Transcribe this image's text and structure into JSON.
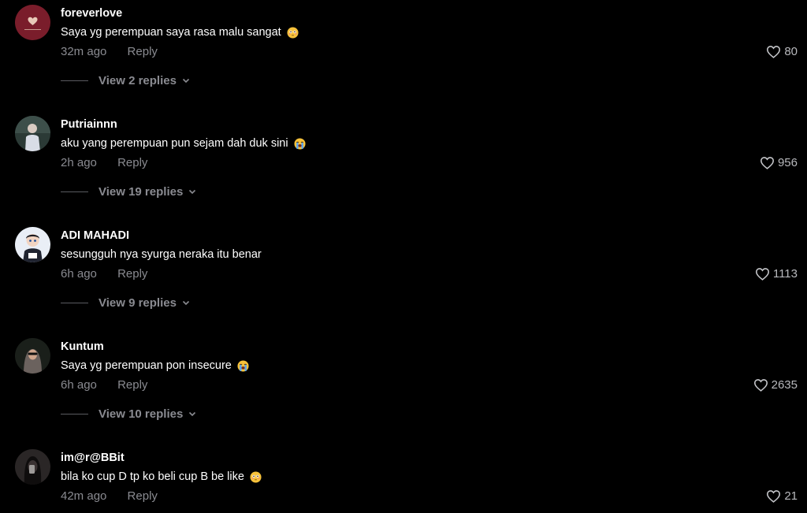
{
  "comments": [
    {
      "username": "foreverlove",
      "text": "Saya yg perempuan saya rasa malu sangat",
      "emoji": "flushed-face-emoji",
      "time": "32m ago",
      "reply": "Reply",
      "likes": "80",
      "replies": "View 2 replies"
    },
    {
      "username": "Putriainnn",
      "text": "aku yang perempuan pun sejam dah duk sini",
      "emoji": "loudly-crying-face-emoji",
      "time": "2h ago",
      "reply": "Reply",
      "likes": "956",
      "replies": "View 19 replies"
    },
    {
      "username": "ADI MAHADI",
      "text": "sesungguh nya syurga neraka itu benar",
      "emoji": "",
      "time": "6h ago",
      "reply": "Reply",
      "likes": "1113",
      "replies": "View 9 replies"
    },
    {
      "username": "Kuntum",
      "text": "Saya yg perempuan pon insecure",
      "emoji": "loudly-crying-face-emoji",
      "time": "6h ago",
      "reply": "Reply",
      "likes": "2635",
      "replies": "View 10 replies"
    },
    {
      "username": "im@r@BBit",
      "text": "bila ko cup D tp ko beli cup B be like",
      "emoji": "flushed-face-emoji",
      "time": "42m ago",
      "reply": "Reply",
      "likes": "21",
      "replies": ""
    }
  ],
  "icons": {
    "like": "heart-outline-icon",
    "expand": "chevron-down-icon"
  },
  "colors": {
    "background": "#000000",
    "text": "#ffffff",
    "muted": "#8a8b91"
  }
}
